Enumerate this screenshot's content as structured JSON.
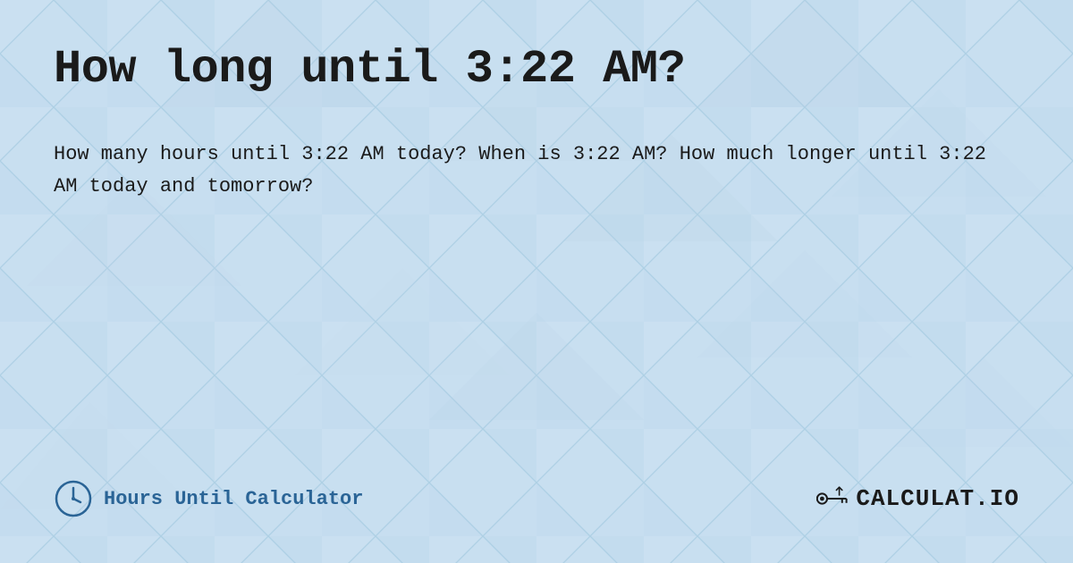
{
  "page": {
    "title": "How long until 3:22 AM?",
    "description": "How many hours until 3:22 AM today? When is 3:22 AM? How much longer until 3:22 AM today and tomorrow?",
    "background_color": "#c8dff0"
  },
  "footer": {
    "brand_label": "Hours Until Calculator",
    "logo_text": "CALCULAT",
    "logo_suffix": ".IO"
  }
}
